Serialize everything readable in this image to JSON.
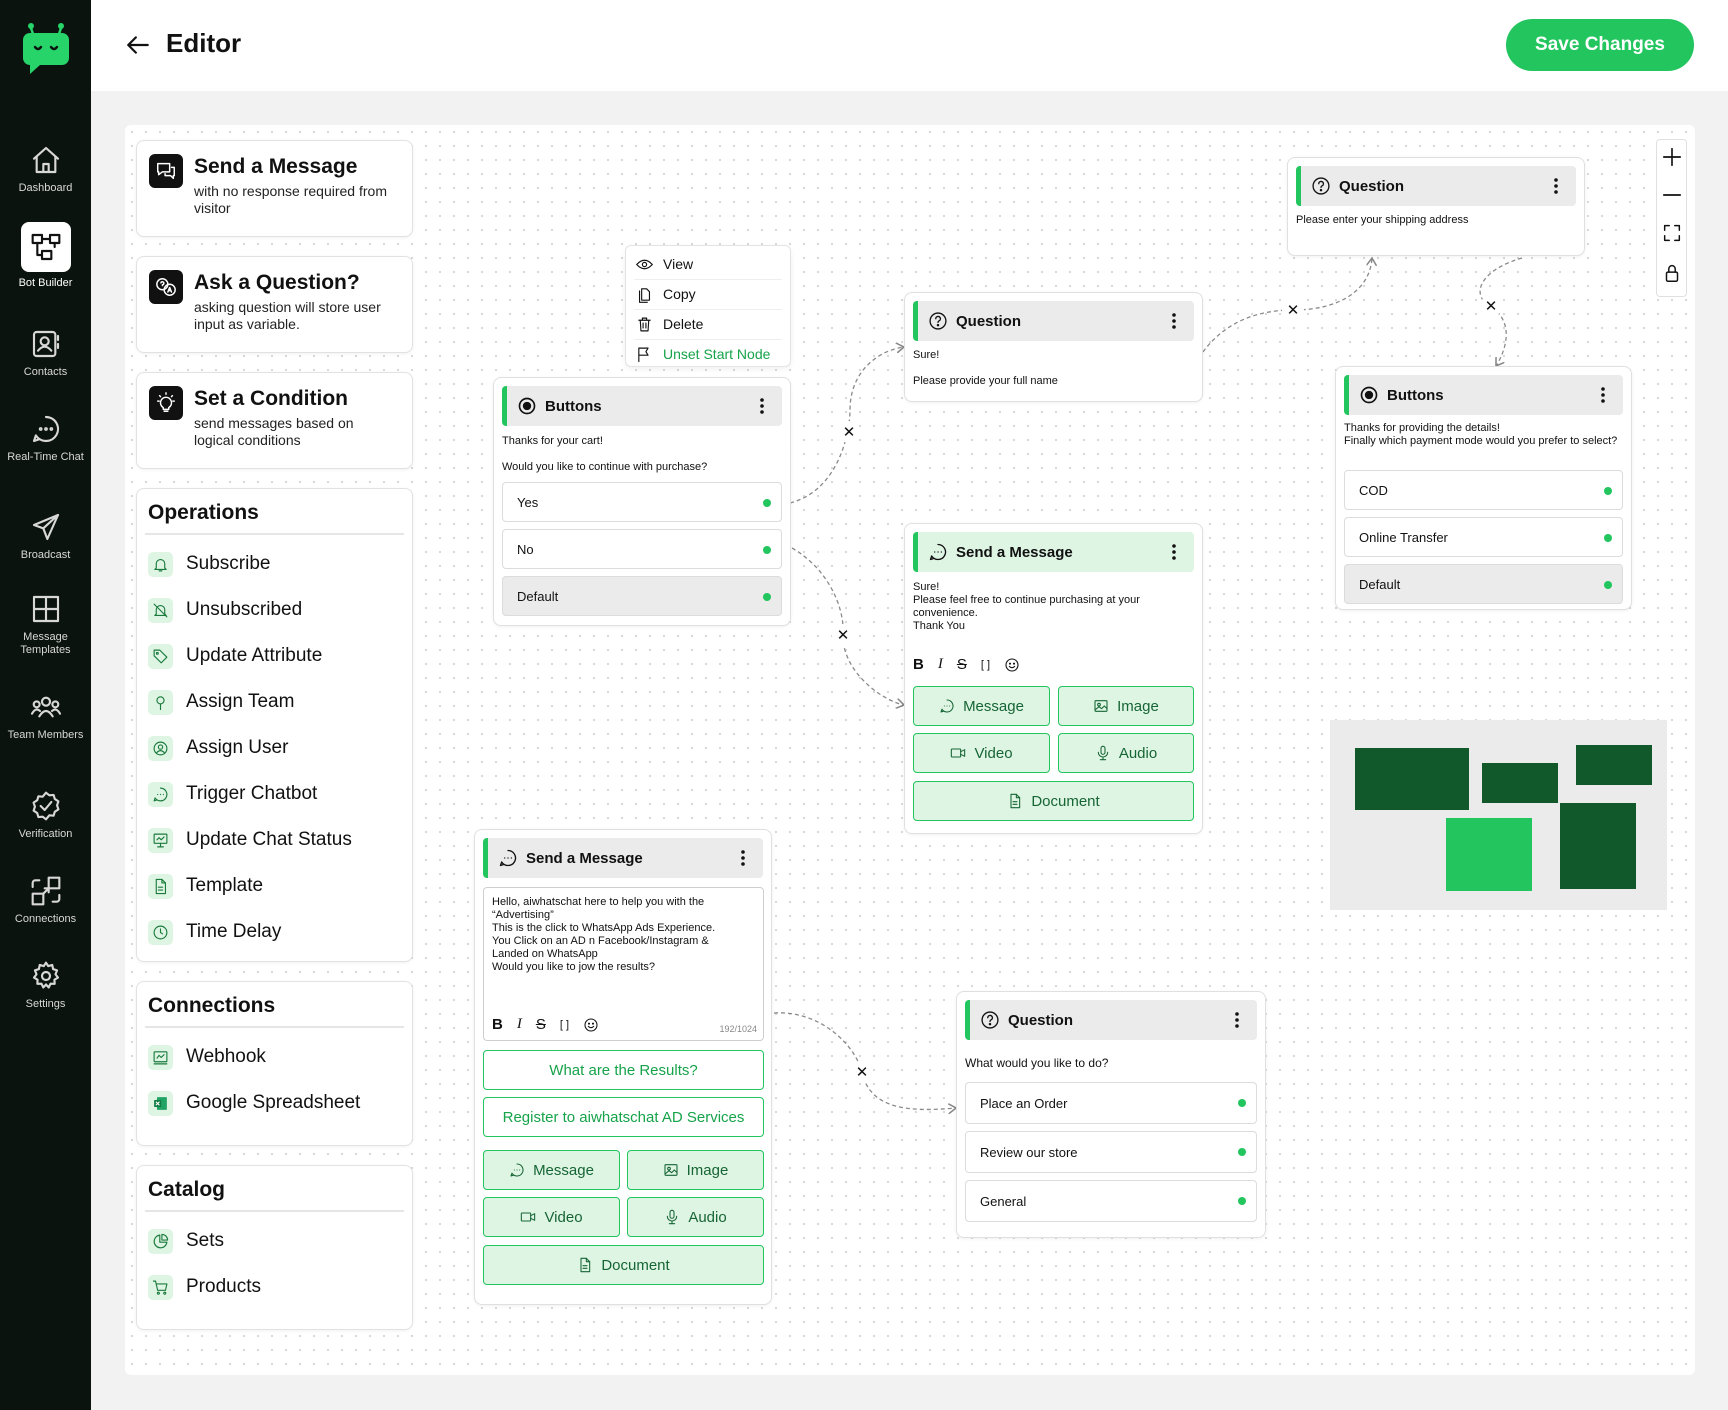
{
  "nav": {
    "items": [
      {
        "label": "Dashboard",
        "icon": "home-icon"
      },
      {
        "label": "Bot Builder",
        "icon": "flow-icon"
      },
      {
        "label": "Contacts",
        "icon": "contacts-icon"
      },
      {
        "label": "Real-Time Chat",
        "icon": "chat-icon"
      },
      {
        "label": "Broadcast",
        "icon": "send-icon"
      },
      {
        "label": "Message Templates",
        "icon": "grid-icon"
      },
      {
        "label": "Team Members",
        "icon": "team-icon"
      },
      {
        "label": "Verification",
        "icon": "verified-icon"
      },
      {
        "label": "Connections",
        "icon": "connections-icon"
      },
      {
        "label": "Settings",
        "icon": "gear-icon"
      }
    ],
    "active": "Bot Builder"
  },
  "header": {
    "title": "Editor",
    "save_label": "Save Changes"
  },
  "palette": {
    "send": {
      "title": "Send a Message",
      "sub": "with no response required from visitor"
    },
    "ask": {
      "title": "Ask a Question?",
      "sub": "asking question will store user input as variable."
    },
    "cond": {
      "title": "Set a Condition",
      "sub": "send messages based on logical conditions"
    },
    "operations": {
      "title": "Operations",
      "items": [
        "Subscribe",
        "Unsubscribed",
        "Update Attribute",
        "Assign Team",
        "Assign User",
        "Trigger Chatbot",
        "Update Chat Status",
        "Template",
        "Time Delay"
      ]
    },
    "connections": {
      "title": "Connections",
      "items": [
        "Webhook",
        "Google Spreadsheet"
      ]
    },
    "catalog": {
      "title": "Catalog",
      "items": [
        "Sets",
        "Products"
      ]
    }
  },
  "context_menu": {
    "view": "View",
    "copy": "Copy",
    "delete": "Delete",
    "unset": "Unset Start Node"
  },
  "nodes": {
    "buttons1": {
      "title": "Buttons",
      "text1": "Thanks for your cart!",
      "text2": "Would you like to continue with purchase?",
      "options": [
        "Yes",
        "No",
        "Default"
      ]
    },
    "question1": {
      "title": "Question",
      "text1": "Sure!",
      "text2": "Please provide your full name"
    },
    "question2": {
      "title": "Question",
      "text1": "Please enter your shipping address"
    },
    "buttons2": {
      "title": "Buttons",
      "text1": "Thanks for providing the details!",
      "text2": "Finally which payment mode would you prefer to select?",
      "options": [
        "COD",
        "Online Transfer",
        "Default"
      ]
    },
    "send1": {
      "title": "Send a Message",
      "lines": [
        "Sure!",
        "Please feel free to continue purchasing at your",
        "convenience.",
        "Thank You"
      ],
      "media": [
        "Message",
        "Image",
        "Video",
        "Audio",
        "Document"
      ]
    },
    "send2": {
      "title": "Send a Message",
      "lines": [
        "Hello, aiwhatschat here to help you with the",
        "“Advertising”",
        "This is the click to WhatsApp Ads Experience.",
        "You Click on an AD n Facebook/Instagram &",
        "Landed on WhatsApp",
        "Would you like to jow the results?"
      ],
      "counter": "192/1024",
      "buttons": [
        "What are the Results?",
        "Register to aiwhatschat AD Services"
      ],
      "media": [
        "Message",
        "Image",
        "Video",
        "Audio",
        "Document"
      ]
    },
    "question3": {
      "title": "Question",
      "text1": "What would you like to do?",
      "options": [
        "Place an Order",
        "Review our store",
        "General"
      ]
    }
  },
  "format_toolbar": {
    "bold": "B",
    "italic": "I",
    "strike": "S",
    "code": "[ ]"
  },
  "colors": {
    "accent": "#22c55e",
    "sidebar": "#0b130e",
    "dark_green": "#11592a",
    "light_green": "#dff5e4"
  }
}
